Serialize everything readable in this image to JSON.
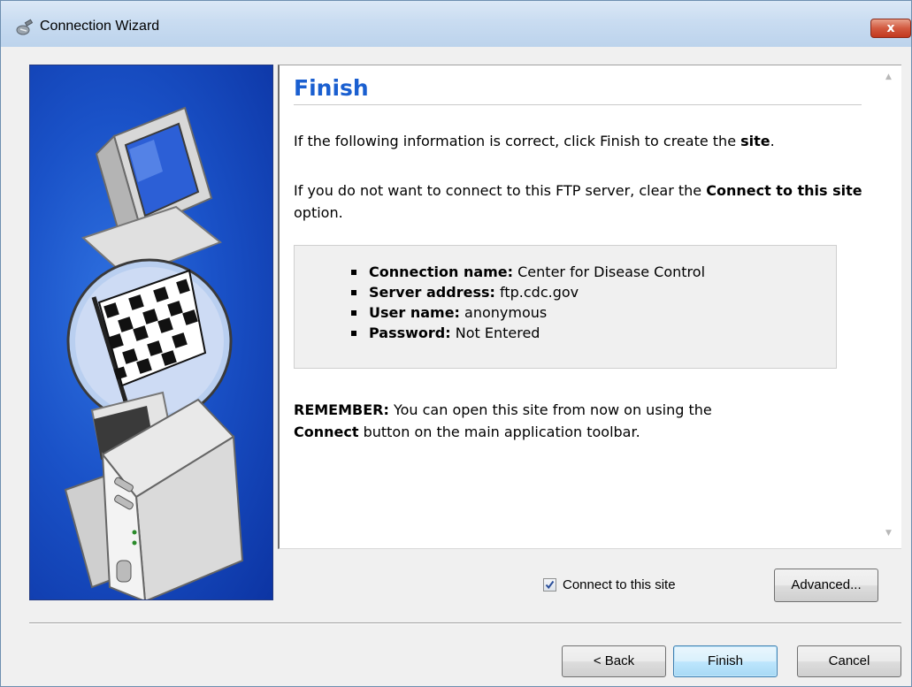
{
  "window": {
    "title": "Connection Wizard",
    "close_label": "x"
  },
  "page": {
    "heading": "Finish",
    "para1_pre": "If the following information is correct, click Finish to create the ",
    "para1_bold": "site",
    "para1_post": ".",
    "para2_pre": "If you do not want to connect to this FTP server, clear the ",
    "para2_bold": "Connect to this site",
    "para2_post": " option.",
    "info": [
      {
        "label": "Connection name:",
        "value": " Center for Disease Control"
      },
      {
        "label": "Server address:",
        "value": " ftp.cdc.gov"
      },
      {
        "label": "User name:",
        "value": " anonymous"
      },
      {
        "label": "Password:",
        "value": " Not Entered"
      }
    ],
    "remember_label": "REMEMBER:",
    "remember_text1": " You can open this site from now on using the ",
    "remember_bold": "Connect",
    "remember_text2": " button on the main application toolbar."
  },
  "options": {
    "connect_label": "Connect to this site",
    "connect_checked": true,
    "advanced_label": "Advanced..."
  },
  "buttons": {
    "back": "< Back",
    "finish": "Finish",
    "cancel": "Cancel"
  },
  "colors": {
    "heading": "#1a5fd0",
    "panel": "#1a52c8",
    "finish_button": "#bee6fd"
  },
  "icons": {
    "title_icon": "connection-icon",
    "wizard_art": "computers-checkered-flag"
  }
}
